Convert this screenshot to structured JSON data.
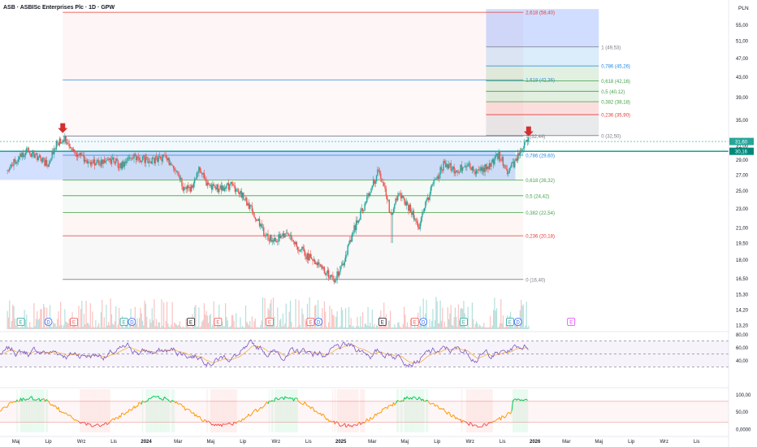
{
  "header": {
    "title": "ASB · ASBISc Enterprises Plc · 1D · GPW"
  },
  "currency": "PLN",
  "colors": {
    "up": "#26a69a",
    "down": "#ef5350",
    "fib_red": "#e53935",
    "fib_green": "#43a047",
    "fib_blue": "#1e88e5",
    "fib_gray": "#787b86",
    "rsi": "#7e57c2",
    "osc_green": "#00c853",
    "price_tag": "#26a69a",
    "zone_blue": "#2962ff",
    "arrow": "#d32f2f"
  },
  "icons": {
    "arrow": "down-arrow-icon",
    "earnings": "earnings-marker-icon",
    "dividend": "dividend-marker-icon"
  },
  "chart_data": [
    {
      "type": "candlestick",
      "name": "price",
      "title": "ASB · ASBISc Enterprises Plc · 1D · GPW",
      "ylabel": "PLN",
      "ylim": [
        13.2,
        60.5
      ],
      "yscale": "log",
      "y_ticks": [
        "55,00",
        "51,00",
        "47,00",
        "43,00",
        "39,00",
        "35,00",
        "31,00",
        "29,00",
        "27,00",
        "25,00",
        "23,00",
        "21,00",
        "19,50",
        "18,00",
        "16,50",
        "15,30",
        "14,20",
        "13,20"
      ],
      "x_ticks": [
        "Maj",
        "Lip",
        "Wrz",
        "Lis",
        "2024",
        "Mar",
        "Maj",
        "Lip",
        "Wrz",
        "Lis",
        "2025",
        "Mar",
        "Maj",
        "Lip",
        "Wrz",
        "Lis",
        "2026",
        "Mar",
        "Maj",
        "Lip",
        "Wrz",
        "Lis"
      ],
      "price_tags": [
        "31,60",
        "30,16"
      ],
      "close_path": [
        [
          "2023-04-15",
          27.5
        ],
        [
          "2023-05-01",
          29.0
        ],
        [
          "2023-05-20",
          30.2
        ],
        [
          "2023-06-10",
          29.5
        ],
        [
          "2023-06-28",
          28.3
        ],
        [
          "2023-07-15",
          31.0
        ],
        [
          "2023-07-28",
          32.3
        ],
        [
          "2023-08-10",
          30.8
        ],
        [
          "2023-09-01",
          29.3
        ],
        [
          "2023-09-25",
          28.4
        ],
        [
          "2023-10-20",
          29.2
        ],
        [
          "2023-11-15",
          28.2
        ],
        [
          "2023-12-10",
          29.3
        ],
        [
          "2024-01-10",
          28.8
        ],
        [
          "2024-02-05",
          29.4
        ],
        [
          "2024-02-25",
          27.5
        ],
        [
          "2024-03-10",
          25.5
        ],
        [
          "2024-03-25",
          25.2
        ],
        [
          "2024-04-10",
          27.6
        ],
        [
          "2024-04-25",
          25.8
        ],
        [
          "2024-05-15",
          25.3
        ],
        [
          "2024-06-10",
          25.7
        ],
        [
          "2024-07-05",
          24.0
        ],
        [
          "2024-07-25",
          22.0
        ],
        [
          "2024-08-10",
          20.3
        ],
        [
          "2024-08-30",
          19.8
        ],
        [
          "2024-09-20",
          20.3
        ],
        [
          "2024-10-10",
          19.3
        ],
        [
          "2024-10-30",
          18.3
        ],
        [
          "2024-11-20",
          17.8
        ],
        [
          "2024-12-05",
          16.9
        ],
        [
          "2024-12-20",
          16.4
        ],
        [
          "2025-01-05",
          17.6
        ],
        [
          "2025-01-15",
          19.3
        ],
        [
          "2025-01-31",
          21.5
        ],
        [
          "2025-02-15",
          23.5
        ],
        [
          "2025-03-01",
          25.8
        ],
        [
          "2025-03-12",
          27.3
        ],
        [
          "2025-03-25",
          25.5
        ],
        [
          "2025-04-05",
          22.0
        ],
        [
          "2025-04-18",
          24.5
        ],
        [
          "2025-05-01",
          23.8
        ],
        [
          "2025-05-15",
          22.5
        ],
        [
          "2025-05-28",
          21.2
        ],
        [
          "2025-06-10",
          23.5
        ],
        [
          "2025-06-25",
          26.0
        ],
        [
          "2025-07-15",
          28.5
        ],
        [
          "2025-08-05",
          27.5
        ],
        [
          "2025-08-25",
          28.2
        ],
        [
          "2025-09-15",
          27.3
        ],
        [
          "2025-10-05",
          28.0
        ],
        [
          "2025-10-25",
          29.6
        ],
        [
          "2025-11-10",
          27.5
        ],
        [
          "2025-11-25",
          28.5
        ],
        [
          "2025-12-10",
          31.0
        ],
        [
          "2025-12-20",
          31.6
        ]
      ],
      "spikes": [
        [
          "2025-04-07",
          19.5
        ]
      ],
      "signal_arrows": [
        [
          "2023-07-28",
          32.4
        ],
        [
          "2025-12-20",
          31.9
        ]
      ]
    },
    {
      "type": "fibonacci_retracement",
      "name": "fib-main",
      "x_range": [
        "2023-07-28",
        "2025-12-10"
      ],
      "label_x": "2025-12-10",
      "levels": [
        {
          "ratio": "1",
          "price": 32.44,
          "label": "1 (32,44)",
          "color": "#787b86"
        },
        {
          "ratio": "0.786",
          "price": 29.6,
          "label": "0,786 (29,60)",
          "color": "#1e88e5"
        },
        {
          "ratio": "0.618",
          "price": 26.32,
          "label": "0,618 (26,32)",
          "color": "#43a047"
        },
        {
          "ratio": "0.5",
          "price": 24.42,
          "label": "0,5 (24,42)",
          "color": "#43a047"
        },
        {
          "ratio": "0.382",
          "price": 22.54,
          "label": "0,382 (22,54)",
          "color": "#43a047"
        },
        {
          "ratio": "0.236",
          "price": 20.18,
          "label": "0,236 (20,18)",
          "color": "#e53935"
        },
        {
          "ratio": "0",
          "price": 16.4,
          "label": "0 (16,40)",
          "color": "#787b86"
        }
      ],
      "extensions": [
        {
          "ratio": "1.618",
          "price": 42.36,
          "label": "1,618 (42,36)",
          "color": "#1e88e5"
        },
        {
          "ratio": "2.618",
          "price": 58.4,
          "label": "2,618 (58,40)",
          "color": "#e53935"
        }
      ]
    },
    {
      "type": "fibonacci_retracement",
      "name": "fib-projection",
      "x_range": [
        "2025-10-01",
        "2026-05-01"
      ],
      "label_x": "2026-05-01",
      "levels": [
        {
          "ratio": "1",
          "price": 49.53,
          "label": "1 (49,53)",
          "color": "#787b86"
        },
        {
          "ratio": "0.786",
          "price": 45.26,
          "label": "0,786 (45,26)",
          "color": "#1e88e5"
        },
        {
          "ratio": "0.618",
          "price": 42.16,
          "label": "0,618 (42,16)",
          "color": "#43a047"
        },
        {
          "ratio": "0.5",
          "price": 40.12,
          "label": "0,5 (40,12)",
          "color": "#43a047"
        },
        {
          "ratio": "0.382",
          "price": 38.18,
          "label": "0,382 (38,18)",
          "color": "#43a047"
        },
        {
          "ratio": "0.236",
          "price": 35.9,
          "label": "0,236 (35,90)",
          "color": "#e53935"
        },
        {
          "ratio": "0",
          "price": 32.5,
          "label": "0 (32,50)",
          "color": "#787b86"
        }
      ]
    },
    {
      "type": "zone",
      "name": "support-resistance-zone",
      "x_range": [
        "2023-04-01",
        "2025-11-25"
      ],
      "price_range": [
        26.32,
        30.16
      ]
    },
    {
      "type": "markers",
      "name": "events",
      "items": [
        {
          "t": "E",
          "x": "2023-05-10",
          "color": "#26a69a"
        },
        {
          "t": "D",
          "x": "2023-07-01",
          "color": "#2962ff"
        },
        {
          "t": "E",
          "x": "2023-08-18",
          "color": "#ef5350"
        },
        {
          "t": "E",
          "x": "2023-11-20",
          "color": "#26a69a"
        },
        {
          "t": "D",
          "x": "2023-12-05",
          "color": "#2962ff"
        },
        {
          "t": "E",
          "x": "2024-03-25",
          "color": "#131722"
        },
        {
          "t": "E",
          "x": "2024-05-15",
          "color": "#ef5350"
        },
        {
          "t": "E",
          "x": "2024-08-20",
          "color": "#ef5350"
        },
        {
          "t": "E",
          "x": "2024-11-05",
          "color": "#ef5350"
        },
        {
          "t": "D",
          "x": "2024-11-20",
          "color": "#2962ff"
        },
        {
          "t": "E",
          "x": "2025-03-20",
          "color": "#131722"
        },
        {
          "t": "E",
          "x": "2025-05-20",
          "color": "#ef5350"
        },
        {
          "t": "D",
          "x": "2025-06-05",
          "color": "#2962ff"
        },
        {
          "t": "E",
          "x": "2025-08-20",
          "color": "#26a69a"
        },
        {
          "t": "E",
          "x": "2025-11-15",
          "color": "#26a69a"
        },
        {
          "t": "D",
          "x": "2025-11-30",
          "color": "#2962ff"
        },
        {
          "t": "E",
          "x": "2026-03-10",
          "color": "#e040fb"
        }
      ]
    },
    {
      "type": "line",
      "name": "rsi",
      "ylim": [
        27,
        83
      ],
      "y_ticks": [
        "80,00",
        "60,00",
        "40,00"
      ],
      "bands": [
        30,
        70
      ],
      "seed": 7
    },
    {
      "type": "line",
      "name": "oscillator",
      "ylim": [
        -10,
        115
      ],
      "y_ticks": [
        "100,00",
        "50,00",
        "0,0000"
      ],
      "bands": [
        20,
        80
      ],
      "seed": 11
    }
  ]
}
